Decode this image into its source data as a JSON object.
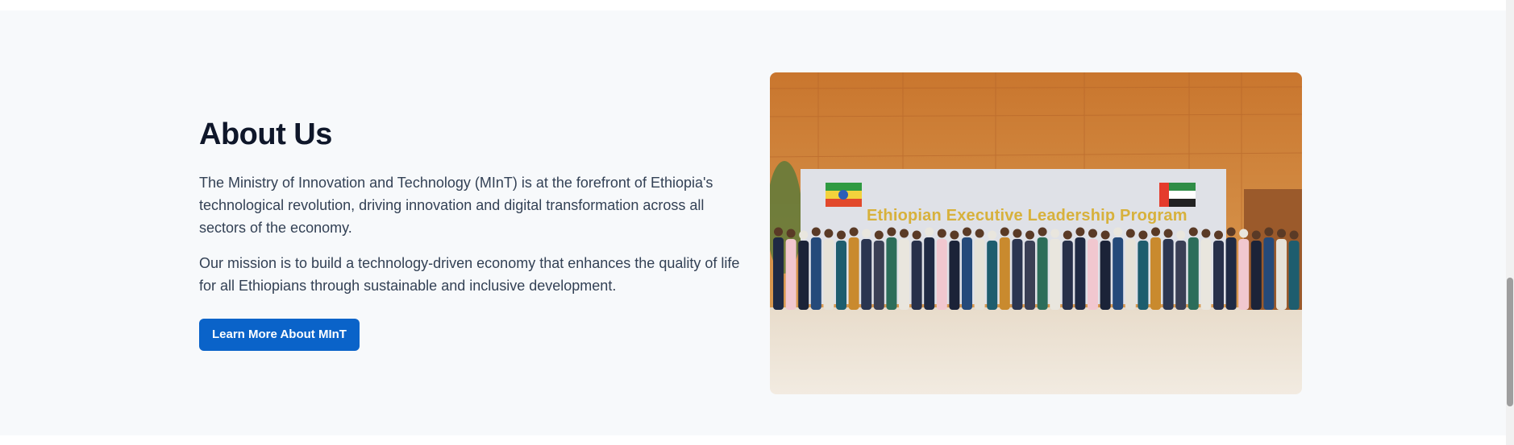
{
  "about": {
    "title": "About Us",
    "paragraph1": "The Ministry of Innovation and Technology (MInT) is at the forefront of Ethiopia's technological revolution, driving innovation and digital transformation across all sectors of the economy.",
    "paragraph2": "Our mission is to build a technology-driven economy that enhances the quality of life for all Ethiopians through sustainable and inclusive development.",
    "button_label": "Learn More About MInT"
  },
  "photo": {
    "banner_text": "Ethiopian Executive Leadership Program"
  },
  "colors": {
    "accent": "#0a63c9",
    "section_background": "#f7f9fb",
    "title": "#0f172a",
    "body_text": "#334155"
  }
}
